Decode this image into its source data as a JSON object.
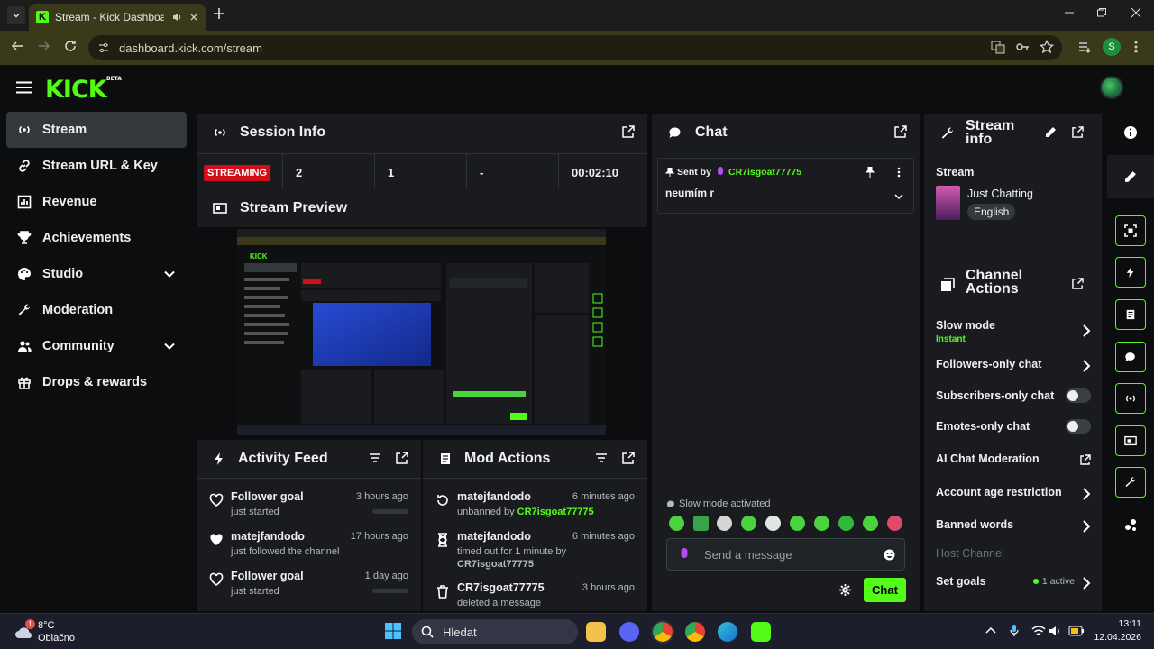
{
  "browser": {
    "tab_title": "Stream - Kick Dashboard",
    "url": "dashboard.kick.com/stream",
    "profile_initial": "S"
  },
  "app": {
    "logo": "KICK",
    "logo_badge": "BETA"
  },
  "sidebar": {
    "items": [
      {
        "label": "Stream",
        "icon": "live-signal-icon"
      },
      {
        "label": "Stream URL & Key",
        "icon": "link-icon"
      },
      {
        "label": "Revenue",
        "icon": "chart-icon"
      },
      {
        "label": "Achievements",
        "icon": "trophy-icon"
      },
      {
        "label": "Studio",
        "icon": "palette-icon"
      },
      {
        "label": "Moderation",
        "icon": "wrench-icon"
      },
      {
        "label": "Community",
        "icon": "users-icon"
      },
      {
        "label": "Drops & rewards",
        "icon": "gift-icon"
      }
    ]
  },
  "session": {
    "title": "Session Info",
    "status": "STREAMING",
    "viewers": "2",
    "followers": "1",
    "subs": "-",
    "duration": "00:02:10"
  },
  "preview": {
    "title": "Stream Preview"
  },
  "activity": {
    "title": "Activity Feed",
    "items": [
      {
        "name": "Follower goal",
        "sub": "just started",
        "time": "3 hours ago"
      },
      {
        "name": "matejfandodo",
        "sub": "just followed the channel",
        "time": "17 hours ago"
      },
      {
        "name": "Follower goal",
        "sub": "just started",
        "time": "1 day ago"
      }
    ]
  },
  "modactions": {
    "title": "Mod Actions",
    "items": [
      {
        "name": "matejfandodo",
        "sub": "unbanned by ",
        "by": "CR7isgoat77775",
        "time": "6 minutes ago"
      },
      {
        "name": "matejfandodo",
        "sub": "timed out for 1 minute by",
        "by": "CR7isgoat77775",
        "time": "6 minutes ago"
      },
      {
        "name": "CR7isgoat77775",
        "sub": "deleted a message",
        "time": "3 hours ago"
      }
    ]
  },
  "chat": {
    "title": "Chat",
    "pinned_prefix": "Sent by",
    "pinned_user": "CR7isgoat77775",
    "pinned_message": "neumím r",
    "slow_mode_notice": "Slow mode activated",
    "input_placeholder": "Send a message",
    "send_label": "Chat"
  },
  "stream_info": {
    "title_line1": "Stream",
    "title_line2": "info",
    "section": "Stream",
    "category": "Just Chatting",
    "language": "English"
  },
  "channel_actions": {
    "title_line1": "Channel",
    "title_line2": "Actions",
    "slow_mode": "Slow mode",
    "slow_mode_value": "Instant",
    "followers_only": "Followers-only chat",
    "subscribers_only": "Subscribers-only chat",
    "emotes_only": "Emotes-only chat",
    "ai_moderation": "AI Chat Moderation",
    "age_restriction": "Account age restriction",
    "banned_words": "Banned words",
    "host_channel": "Host Channel",
    "set_goals": "Set goals",
    "set_goals_count": "1 active"
  },
  "taskbar": {
    "weather_temp": "8°C",
    "weather_desc": "Oblačno",
    "weather_badge": "1",
    "search_placeholder": "Hledat",
    "time": "13:11",
    "date": "12.04.2026"
  },
  "colors": {
    "accent": "#53fc18",
    "live": "#d40e17",
    "panel": "#191b1f",
    "background": "#0b0d0e"
  }
}
